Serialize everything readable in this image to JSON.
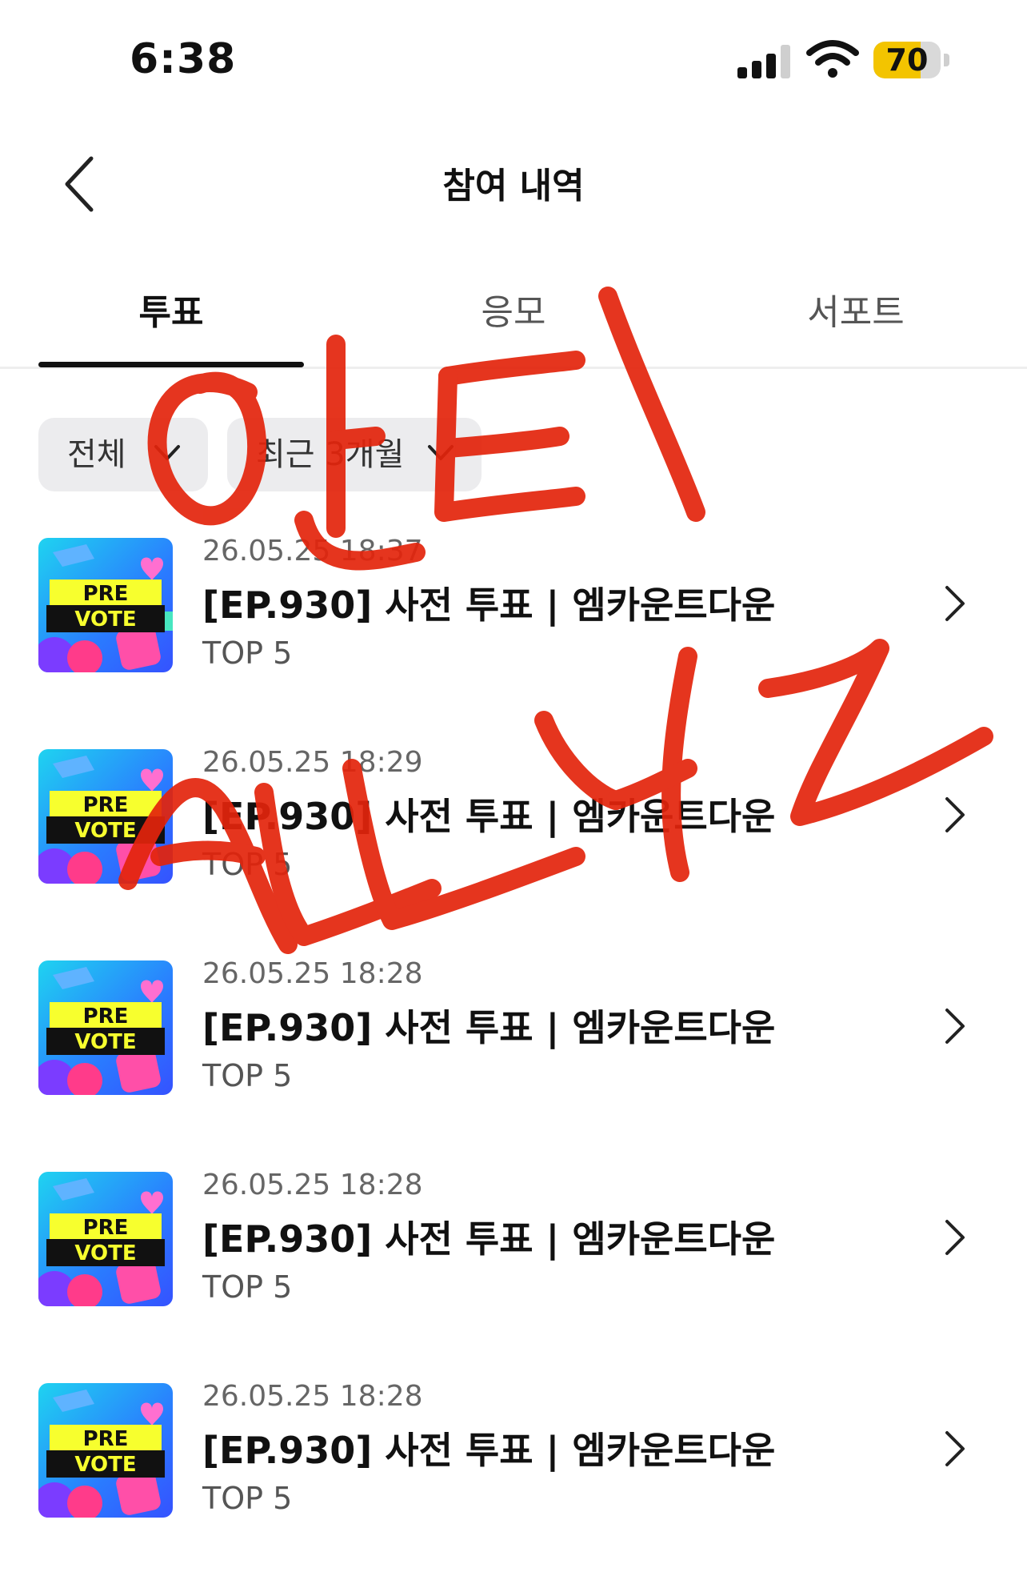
{
  "status": {
    "time": "6:38",
    "battery": "70",
    "battery_level": 0.7
  },
  "header": {
    "title": "참여 내역"
  },
  "tabs": [
    {
      "label": "투표",
      "active": true
    },
    {
      "label": "응모",
      "active": false
    },
    {
      "label": "서포트",
      "active": false
    }
  ],
  "filters": {
    "category": "전체",
    "period": "최근 3개월"
  },
  "items": [
    {
      "date": "26.05.25 18:37",
      "title": "[EP.930] 사전 투표 | 엠카운트다운",
      "sub": "TOP 5",
      "thumb_top": "PRE",
      "thumb_bottom": "VOTE"
    },
    {
      "date": "26.05.25 18:29",
      "title": "[EP.930] 사전 투표 | 엠카운트다운",
      "sub": "TOP 5",
      "thumb_top": "PRE",
      "thumb_bottom": "VOTE"
    },
    {
      "date": "26.05.25 18:28",
      "title": "[EP.930] 사전 투표 | 엠카운트다운",
      "sub": "TOP 5",
      "thumb_top": "PRE",
      "thumb_bottom": "VOTE"
    },
    {
      "date": "26.05.25 18:28",
      "title": "[EP.930] 사전 투표 | 엠카운트다운",
      "sub": "TOP 5",
      "thumb_top": "PRE",
      "thumb_bottom": "VOTE"
    },
    {
      "date": "26.05.25 18:28",
      "title": "[EP.930] 사전 투표 | 엠카운트다운",
      "sub": "TOP 5",
      "thumb_top": "PRE",
      "thumb_bottom": "VOTE"
    }
  ],
  "colors": {
    "accent": "#111111",
    "chip_bg": "#ececee",
    "graffiti": "#e3240c",
    "battery_fill": "#f3c400"
  },
  "icons": {
    "back": "chevron-left-icon",
    "row": "chevron-right-icon",
    "dropdown": "chevron-down-icon"
  }
}
